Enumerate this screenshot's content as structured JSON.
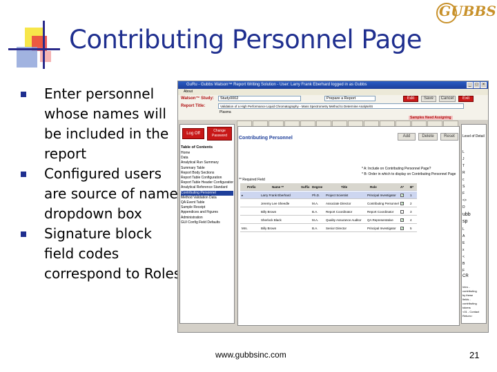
{
  "slide": {
    "title": "Contributing Personnel Page",
    "logo_text": "GUBBS",
    "bullets": [
      "Enter personnel whose names will be included in the report",
      "Configured users are source of name dropdown box",
      "Signature block field codes correspond to Roles"
    ],
    "footer_url": "www.gubbsinc.com",
    "page_number": "21"
  },
  "colors": {
    "title": "#1f2f8f",
    "accent_yellow": "#f7e64a",
    "accent_red": "#e94040",
    "accent_blue": "#8aa0d8",
    "window_blue": "#1e3f9a",
    "button_red": "#c81818"
  },
  "screenshot": {
    "window_title": "GuRu - Gubbs Watson™ Report Writing Solution - User: Larry Frank Eberhard logged in as Gubbs",
    "menu": "About",
    "study_label": "Watson™ Study:",
    "study_value": "Study0002",
    "report_title_label": "Report Title:",
    "report_title_value": "Validation of a High Performance Liquid Chromatography - Mass Spectrometry Method to Determine Analyte/IS",
    "report_title_line2": "Plasma",
    "prepare_value": "Prepare a Report",
    "buttons": {
      "edit": "Edit",
      "save": "Save",
      "cancel": "Cancel",
      "exit": "Exit",
      "logoff": "Log Off",
      "change_password": "Change Password",
      "add": "Add",
      "delete": "Delete",
      "reset": "Reset"
    },
    "status_banner": "Samples Need Assigning",
    "toc_title": "Table of Contents",
    "toc_items": [
      "Home",
      "Data",
      "Analytical Run Summary",
      "Summary Table",
      "Report Body Sections",
      "Report Table Configuration",
      "Report Table Header Configuration",
      "Analytical Reference Standard",
      "Contributing Personnel",
      "Method Validation Data",
      "QA Event Table",
      "Sample Receipt",
      "Appendices and Figures",
      "Administration",
      "GUI Config Field Defaults"
    ],
    "toc_selected_index": 8,
    "heading": "Contributing Personnel",
    "notes": [
      "* A: Include on Contributing Personnel Page?",
      "* B: Order in which to display on Contributing Personnel Page"
    ],
    "required_field": "** Required Field",
    "grid": {
      "columns": [
        "Prefix",
        "Name **",
        "Suffix",
        "Degree",
        "Title",
        "Role",
        "A*",
        "B*"
      ],
      "rows": [
        {
          "prefix": "",
          "name": "Larry Frank Eberhard",
          "suffix": "",
          "degree": "Ph.D.",
          "title": "Project Scientist",
          "role": "Principal Investigator",
          "a": true,
          "b": "1"
        },
        {
          "prefix": "",
          "name": "Jeremy Lee Sheedle",
          "suffix": "",
          "degree": "M.A.",
          "title": "Associate Director",
          "role": "Contributing Personnel",
          "a": true,
          "b": "2"
        },
        {
          "prefix": "",
          "name": "Billy Brown",
          "suffix": "",
          "degree": "B.A.",
          "title": "Report Coordinator",
          "role": "Report Coordinator",
          "a": false,
          "b": "3"
        },
        {
          "prefix": "",
          "name": "Sherlock Black",
          "suffix": "",
          "degree": "M.A.",
          "title": "Quality Assurance Auditor",
          "role": "QA Representative",
          "a": true,
          "b": "4"
        },
        {
          "prefix": "Mrs.",
          "name": "Billy Brown",
          "suffix": "",
          "degree": "B.A.",
          "title": "Senior Director",
          "role": "Principal Investigator",
          "a": true,
          "b": "5"
        }
      ]
    },
    "right_panel_label": "Level of Detail",
    "right_panel_lines": [
      "L",
      "J",
      "T",
      "R",
      "c",
      "S",
      "F",
      "<>",
      "D",
      "ubb",
      "sp",
      "L",
      "A",
      "E",
      "x",
      "<",
      "B",
      "F",
      "CR"
    ],
    "right_panel_footer": [
      "Intro -",
      "contributing",
      "by these",
      "fields -",
      "contributing",
      "tokens",
      "<01 - Contact",
      "Return>"
    ]
  }
}
